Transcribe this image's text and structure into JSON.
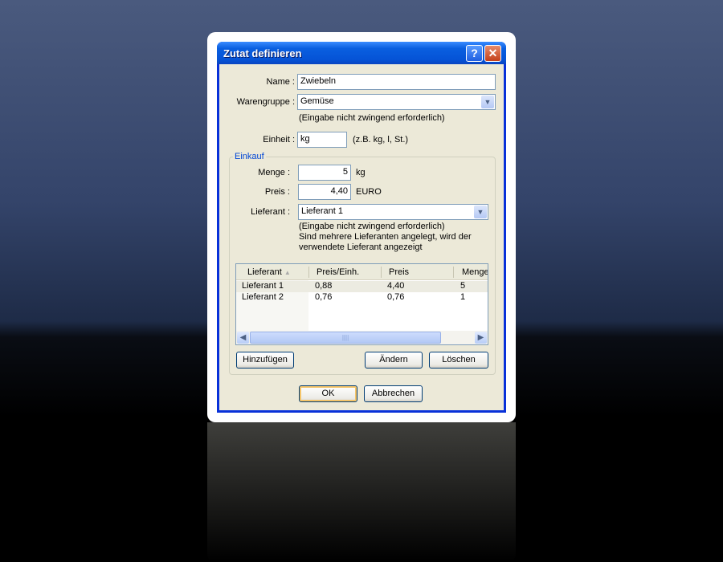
{
  "window": {
    "title": "Zutat definieren",
    "help_icon": "?",
    "close_icon": "✕"
  },
  "form": {
    "name_label": "Name :",
    "name_value": "Zwiebeln",
    "warengruppe_label": "Warengruppe :",
    "warengruppe_value": "Gemüse",
    "warengruppe_hint": "(Eingabe nicht zwingend erforderlich)",
    "einheit_label": "Einheit :",
    "einheit_value": "kg",
    "einheit_hint": "(z.B. kg, l, St.)"
  },
  "einkauf": {
    "legend": "Einkauf",
    "menge_label": "Menge :",
    "menge_value": "5",
    "menge_unit": "kg",
    "preis_label": "Preis :",
    "preis_value": "4,40",
    "preis_unit": "EURO",
    "lieferant_label": "Lieferant :",
    "lieferant_value": "Lieferant 1",
    "lieferant_hint1": "(Eingabe nicht zwingend erforderlich)",
    "lieferant_hint2": "Sind mehrere Lieferanten angelegt, wird der",
    "lieferant_hint3": "verwendete Lieferant angezeigt",
    "table": {
      "columns": [
        "Lieferant",
        "Preis/Einh.",
        "Preis",
        "Menge"
      ],
      "rows": [
        [
          "Lieferant 1",
          "0,88",
          "4,40",
          "5"
        ],
        [
          "Lieferant 2",
          "0,76",
          "0,76",
          "1"
        ]
      ]
    },
    "add_button": "Hinzufügen",
    "edit_button": "Ändern",
    "delete_button": "Löschen"
  },
  "footer": {
    "ok_button": "OK",
    "cancel_button": "Abbrechen"
  }
}
